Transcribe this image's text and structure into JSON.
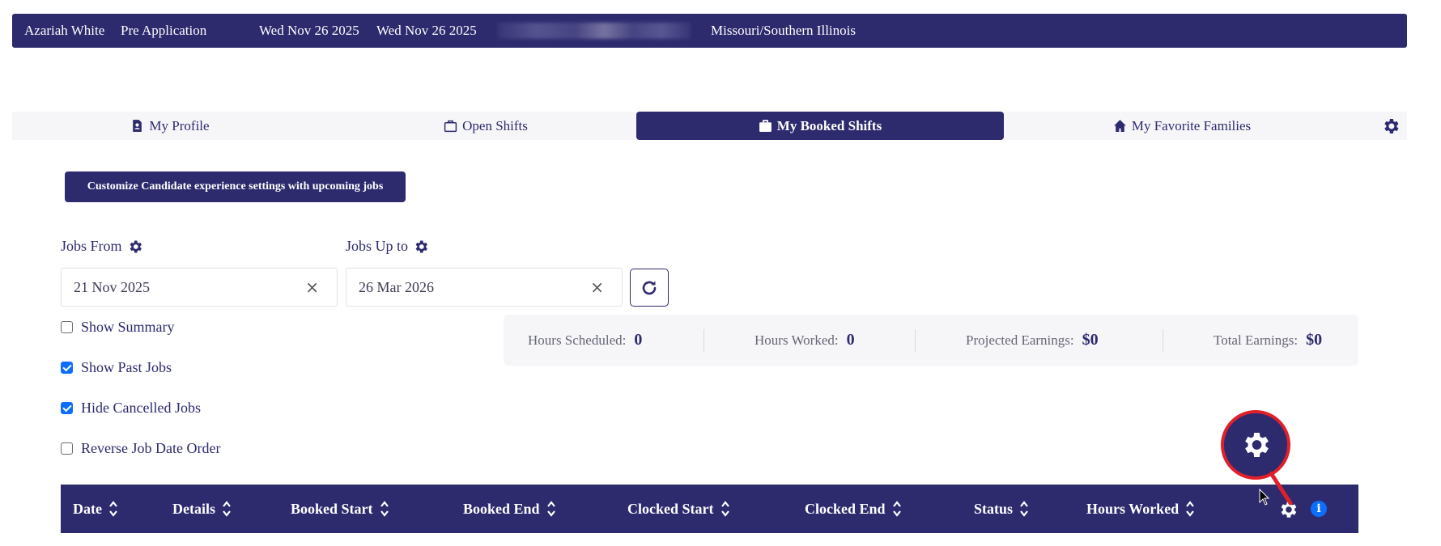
{
  "banner": {
    "name": "Azariah White",
    "status": "Pre Application",
    "date1": "Wed Nov 26 2025",
    "date2": "Wed Nov 26 2025",
    "region": "Missouri/Southern Illinois"
  },
  "tabs": [
    {
      "label": "My Profile",
      "icon": "profile-icon"
    },
    {
      "label": "Open Shifts",
      "icon": "briefcase-outline-icon"
    },
    {
      "label": "My Booked Shifts",
      "icon": "briefcase-icon",
      "active": true
    },
    {
      "label": "My Favorite Families",
      "icon": "home-icon"
    }
  ],
  "customize_button": "Customize Candidate experience settings with upcoming jobs",
  "filters": {
    "jobs_from_label": "Jobs From",
    "jobs_from_value": "21 Nov 2025",
    "jobs_to_label": "Jobs Up to",
    "jobs_to_value": "26 Mar 2026",
    "clear_symbol": "×"
  },
  "checkboxes": [
    {
      "label": "Show Summary",
      "checked": false
    },
    {
      "label": "Show Past Jobs",
      "checked": true
    },
    {
      "label": "Hide Cancelled Jobs",
      "checked": true
    },
    {
      "label": "Reverse Job Date Order",
      "checked": false
    }
  ],
  "summary": {
    "hours_scheduled_label": "Hours Scheduled:",
    "hours_scheduled_value": "0",
    "hours_worked_label": "Hours Worked:",
    "hours_worked_value": "0",
    "projected_label": "Projected Earnings:",
    "projected_value": "$0",
    "total_label": "Total Earnings:",
    "total_value": "$0"
  },
  "table": {
    "columns": [
      "Date",
      "Details",
      "Booked Start",
      "Booked End",
      "Clocked Start",
      "Clocked End",
      "Status",
      "Hours Worked"
    ]
  },
  "info_symbol": "i",
  "colors": {
    "primary": "#2d2a6e",
    "highlight": "#e0202a",
    "info": "#0d6efd"
  }
}
